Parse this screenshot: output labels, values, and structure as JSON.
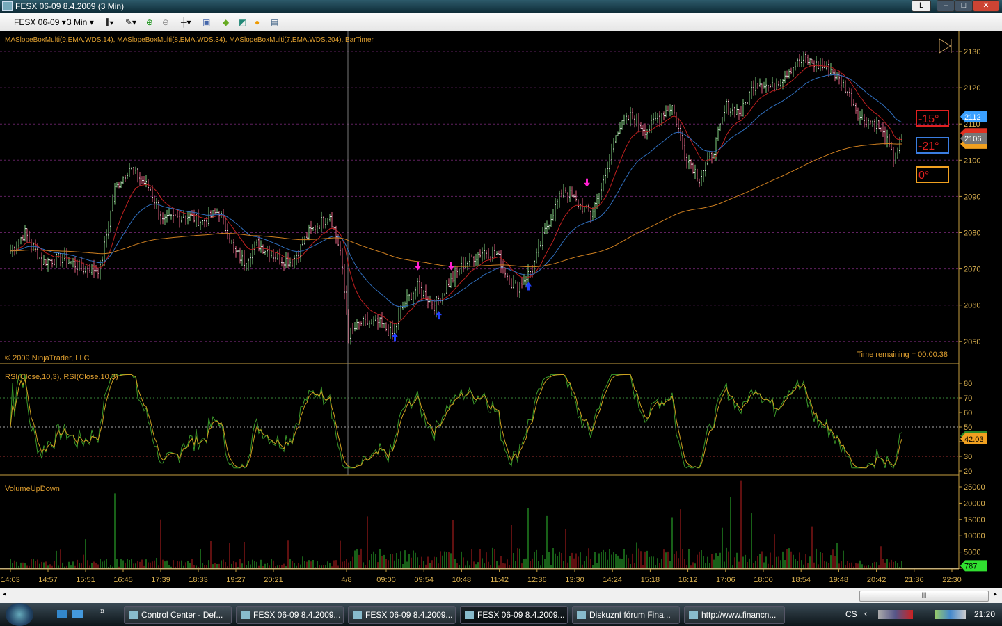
{
  "window": {
    "title": "FESX 06-09  8.4.2009 (3 Min)",
    "btn_l": "L",
    "btn_min": "–",
    "btn_max": "□",
    "btn_close": "✕"
  },
  "toolbar": {
    "instrument": "FESX 06-09",
    "interval": "3 Min",
    "dropdown": "▾"
  },
  "panels": {
    "price": {
      "indicators": "MASlopeBoxMulti(9,EMA,WDS,14), MASlopeBoxMulti(8,EMA,WDS,34), MASlopeBoxMulti(7,EMA,WDS,204), BarTimer",
      "copyright": "© 2009 NinjaTrader, LLC",
      "time_remaining": "Time remaining = 00:00:38",
      "slope_boxes": [
        {
          "label": "-15°",
          "color": "#e02020"
        },
        {
          "label": "-21°",
          "color": "#3a7de0"
        },
        {
          "label": "0°",
          "color": "#f0a020"
        }
      ],
      "price_markers": [
        {
          "label": "2112",
          "color": "#3aa0ff"
        },
        {
          "label": "2106",
          "color": "#777777"
        }
      ]
    },
    "rsi": {
      "label": "RSI(Close,10,3), RSI(Close,10,3)",
      "marker": "42.03"
    },
    "volume": {
      "label": "VolumeUpDown",
      "marker": "787"
    }
  },
  "chart_data": {
    "type": "candlestick",
    "price_axis": {
      "ticks": [
        2050,
        2060,
        2070,
        2080,
        2090,
        2100,
        2110,
        2120,
        2130
      ],
      "range": [
        2044,
        2135
      ]
    },
    "rsi_axis": {
      "ticks": [
        20,
        30,
        40,
        50,
        60,
        70,
        80
      ],
      "levels": [
        30,
        50,
        70
      ]
    },
    "volume_axis": {
      "ticks": [
        0,
        5000,
        10000,
        15000,
        20000,
        25000
      ],
      "max": 27000
    },
    "x_labels": [
      "14:03",
      "14:57",
      "15:51",
      "16:45",
      "17:39",
      "18:33",
      "19:27",
      "20:21",
      "4/8",
      "09:00",
      "09:54",
      "10:48",
      "11:42",
      "12:36",
      "13:30",
      "14:24",
      "15:18",
      "16:12",
      "17:06",
      "18:00",
      "18:54",
      "19:48",
      "20:42",
      "21:36",
      "22:30"
    ],
    "close_anchors_bar_price": [
      [
        0,
        2075
      ],
      [
        7,
        2080
      ],
      [
        15,
        2072
      ],
      [
        25,
        2073
      ],
      [
        35,
        2070
      ],
      [
        43,
        2070
      ],
      [
        50,
        2092
      ],
      [
        57,
        2098
      ],
      [
        62,
        2095
      ],
      [
        67,
        2092
      ],
      [
        73,
        2083
      ],
      [
        83,
        2085
      ],
      [
        92,
        2083
      ],
      [
        100,
        2086
      ],
      [
        107,
        2075
      ],
      [
        112,
        2072
      ],
      [
        118,
        2077
      ],
      [
        128,
        2073
      ],
      [
        135,
        2072
      ],
      [
        143,
        2080
      ],
      [
        153,
        2085
      ],
      [
        158,
        2075
      ],
      [
        162,
        2052
      ],
      [
        168,
        2055
      ],
      [
        177,
        2055
      ],
      [
        183,
        2052
      ],
      [
        188,
        2060
      ],
      [
        195,
        2065
      ],
      [
        203,
        2060
      ],
      [
        210,
        2066
      ],
      [
        218,
        2072
      ],
      [
        227,
        2075
      ],
      [
        233,
        2074
      ],
      [
        240,
        2066
      ],
      [
        243,
        2065
      ],
      [
        250,
        2070
      ],
      [
        257,
        2082
      ],
      [
        265,
        2092
      ],
      [
        272,
        2088
      ],
      [
        278,
        2085
      ],
      [
        285,
        2095
      ],
      [
        290,
        2108
      ],
      [
        297,
        2112
      ],
      [
        305,
        2108
      ],
      [
        310,
        2112
      ],
      [
        317,
        2115
      ],
      [
        323,
        2102
      ],
      [
        330,
        2095
      ],
      [
        337,
        2103
      ],
      [
        343,
        2115
      ],
      [
        350,
        2113
      ],
      [
        357,
        2122
      ],
      [
        365,
        2120
      ],
      [
        373,
        2125
      ],
      [
        380,
        2128
      ],
      [
        387,
        2126
      ],
      [
        393,
        2125
      ],
      [
        400,
        2120
      ],
      [
        407,
        2112
      ],
      [
        415,
        2110
      ],
      [
        420,
        2105
      ],
      [
        423,
        2100
      ],
      [
        427,
        2106
      ]
    ],
    "session_break_bar": 161,
    "volume_peaks_bar_value": [
      [
        50,
        23000
      ],
      [
        72,
        15000
      ],
      [
        345,
        22000
      ],
      [
        350,
        27000
      ],
      [
        355,
        17000
      ]
    ]
  },
  "taskbar": {
    "items": [
      "Control Center - Def...",
      "FESX 06-09  8.4.2009...",
      "FESX 06-09  8.4.2009...",
      "FESX 06-09  8.4.2009...",
      "Diskuzní fórum Fina...",
      "http://www.financn..."
    ],
    "lang": "CS",
    "clock": "21:20"
  }
}
